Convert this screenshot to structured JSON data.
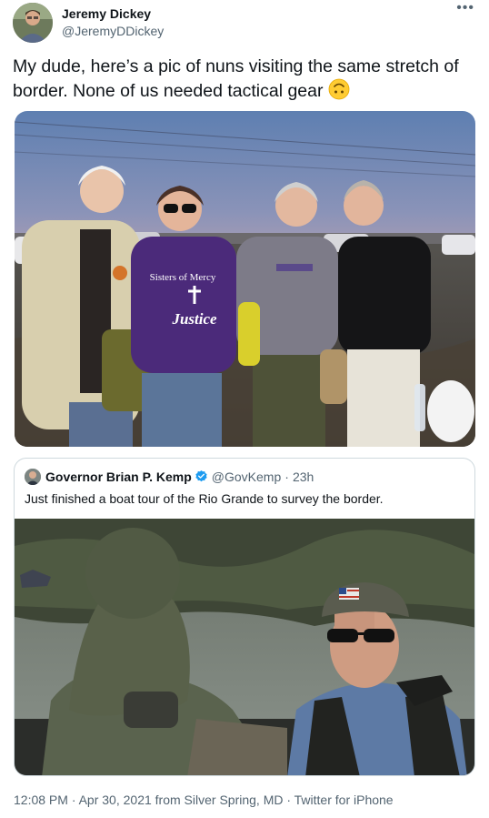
{
  "author": {
    "name": "Jeremy Dickey",
    "handle": "@JeremyDDickey",
    "avatar_icon": "profile-avatar"
  },
  "more_icon": "•••",
  "tweet": {
    "text": "My dude, here’s a pic of nuns visiting the same stretch of border. None of us needed tactical gear",
    "emoji_icon": "upside-down-face-emoji"
  },
  "photo": {
    "shirt_text_1": "Sisters of Mercy",
    "shirt_text_2": "Justice"
  },
  "quoted_tweet": {
    "name": "Governor Brian P. Kemp",
    "handle": "@GovKemp",
    "separator": "·",
    "time": "23h",
    "text": "Just finished a boat tour of the Rio Grande to survey the border.",
    "verified_icon": "verified-badge-icon"
  },
  "footer": {
    "timestamp": "12:08 PM · Apr 30, 2021 from Silver Spring, MD · Twitter for iPhone"
  },
  "colors": {
    "text": "#0f1419",
    "secondary": "#536471",
    "verified": "#1d9bf0",
    "border": "#cfd9de"
  }
}
